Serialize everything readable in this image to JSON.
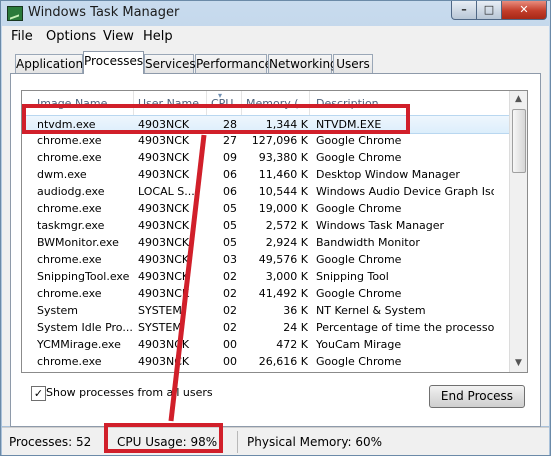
{
  "window": {
    "title": "Windows Task Manager",
    "controls": {
      "minimize": "–",
      "maximize": "□",
      "close": "✕"
    }
  },
  "menu": [
    "File",
    "Options",
    "View",
    "Help"
  ],
  "tabs": [
    "Applications",
    "Processes",
    "Services",
    "Performance",
    "Networking",
    "Users"
  ],
  "active_tab": "Processes",
  "columns": [
    "Image Name",
    "User Name",
    "CPU",
    "Memory (",
    "Description"
  ],
  "rows": [
    {
      "image": "ntvdm.exe",
      "user": "4903NCK",
      "cpu": "28",
      "memory": "1,344 K",
      "description": "NTVDM.EXE",
      "selected": true
    },
    {
      "image": "chrome.exe",
      "user": "4903NCK",
      "cpu": "27",
      "memory": "127,096 K",
      "description": "Google Chrome"
    },
    {
      "image": "chrome.exe",
      "user": "4903NCK",
      "cpu": "09",
      "memory": "93,380 K",
      "description": "Google Chrome"
    },
    {
      "image": "dwm.exe",
      "user": "4903NCK",
      "cpu": "06",
      "memory": "11,460 K",
      "description": "Desktop Window Manager"
    },
    {
      "image": "audiodg.exe",
      "user": "LOCAL S...",
      "cpu": "06",
      "memory": "10,544 K",
      "description": "Windows Audio Device Graph Isola..."
    },
    {
      "image": "chrome.exe",
      "user": "4903NCK",
      "cpu": "05",
      "memory": "19,000 K",
      "description": "Google Chrome"
    },
    {
      "image": "taskmgr.exe",
      "user": "4903NCK",
      "cpu": "05",
      "memory": "2,572 K",
      "description": "Windows Task Manager"
    },
    {
      "image": "BWMonitor.exe",
      "user": "4903NCK",
      "cpu": "05",
      "memory": "2,924 K",
      "description": "Bandwidth Monitor"
    },
    {
      "image": "chrome.exe",
      "user": "4903NCK",
      "cpu": "03",
      "memory": "49,576 K",
      "description": "Google Chrome"
    },
    {
      "image": "SnippingTool.exe",
      "user": "4903NCK",
      "cpu": "02",
      "memory": "3,000 K",
      "description": "Snipping Tool"
    },
    {
      "image": "chrome.exe",
      "user": "4903NCK",
      "cpu": "02",
      "memory": "41,492 K",
      "description": "Google Chrome"
    },
    {
      "image": "System",
      "user": "SYSTEM",
      "cpu": "02",
      "memory": "36 K",
      "description": "NT Kernel & System"
    },
    {
      "image": "System Idle Pro...",
      "user": "SYSTEM",
      "cpu": "02",
      "memory": "24 K",
      "description": "Percentage of time the processor i..."
    },
    {
      "image": "YCMMirage.exe",
      "user": "4903NCK",
      "cpu": "00",
      "memory": "472 K",
      "description": "YouCam Mirage"
    },
    {
      "image": "chrome.exe",
      "user": "4903NCK",
      "cpu": "00",
      "memory": "26,616 K",
      "description": "Google Chrome"
    }
  ],
  "show_all_users": "Show processes from all users",
  "show_all_checked": "✓",
  "end_process": "End Process",
  "status": {
    "processes": "Processes: 52",
    "cpu": "CPU Usage: 98%",
    "memory": "Physical Memory: 60%"
  },
  "colors": {
    "annotation": "#d11f2a"
  }
}
